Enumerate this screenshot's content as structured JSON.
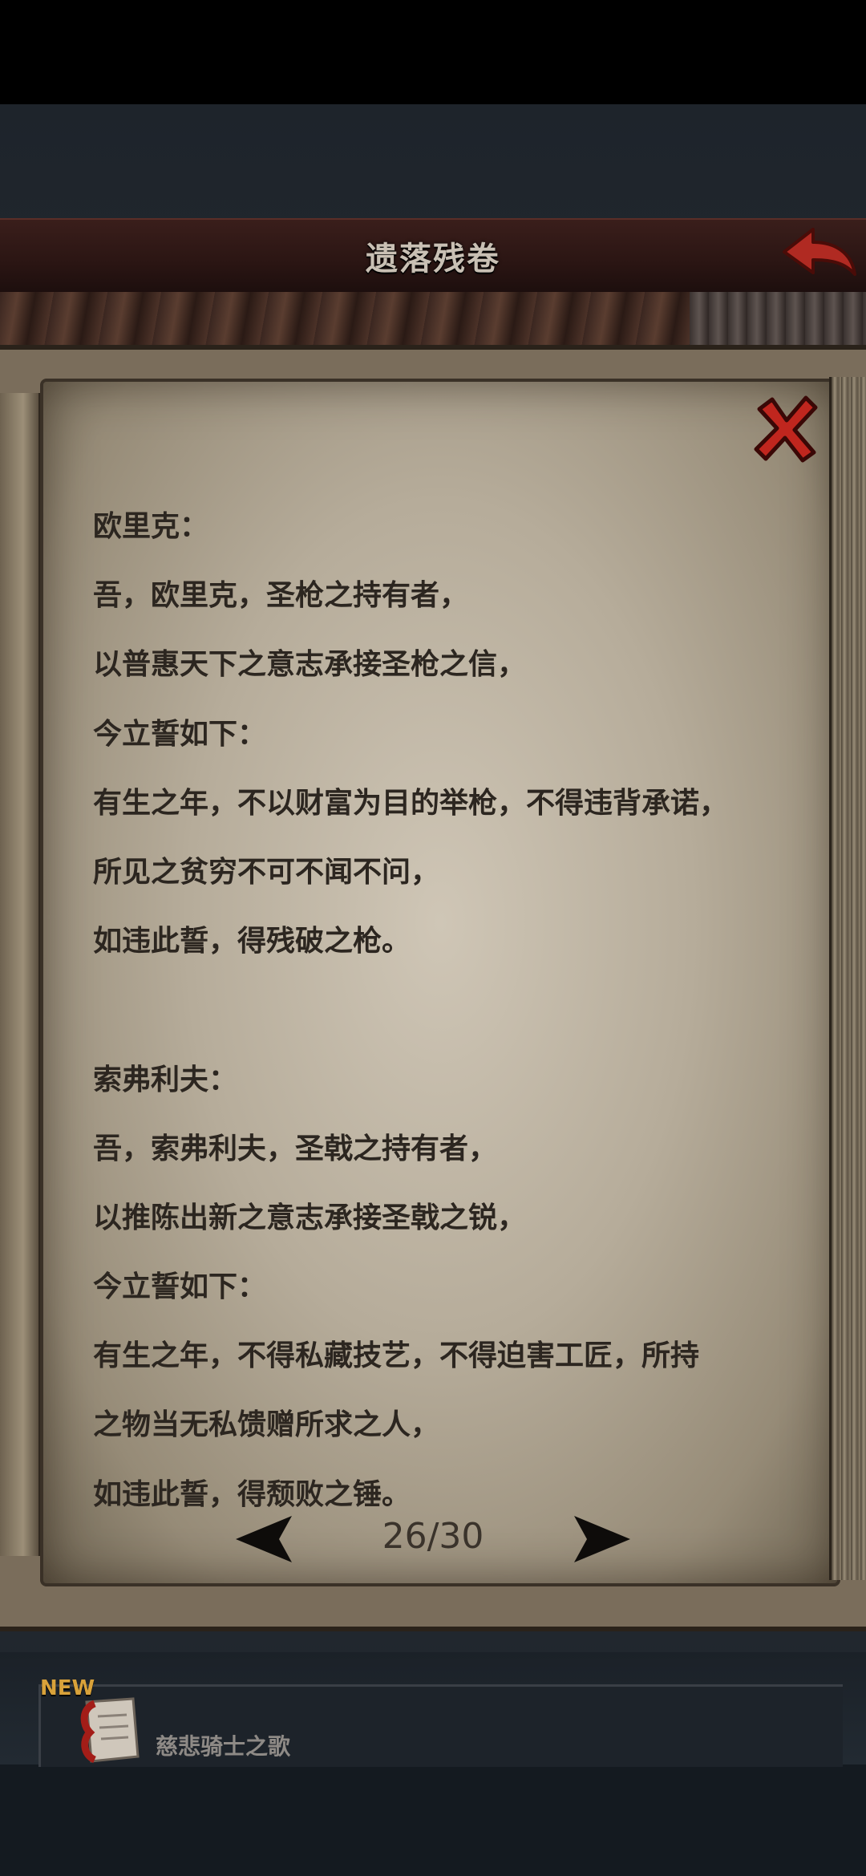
{
  "header": {
    "title": "遗落残卷"
  },
  "document": {
    "lines": [
      "欧里克：",
      "吾，欧里克，圣枪之持有者，",
      "以普惠天下之意志承接圣枪之信，",
      "今立誓如下：",
      "有生之年，不以财富为目的举枪，不得违背承诺，",
      "所见之贫穷不可不闻不问，",
      "如违此誓，得残破之枪。",
      "",
      "索弗利夫：",
      "吾，索弗利夫，圣戟之持有者，",
      "以推陈出新之意志承接圣戟之锐，",
      "今立誓如下：",
      "有生之年，不得私藏技艺，不得迫害工匠，所持",
      "之物当无私馈赠所求之人，",
      "如违此誓，得颓败之锤。"
    ]
  },
  "pager": {
    "page": "26/30",
    "current": 26,
    "total": 30
  },
  "list": {
    "items": [
      {
        "badge": "NEW",
        "label": "慈悲骑士之歌",
        "icon": "scroll-icon"
      }
    ]
  },
  "icons": {
    "back": "back-arrow-icon",
    "close": "close-icon",
    "prev": "prev-page-icon",
    "next": "next-page-icon"
  },
  "colors": {
    "header_bg": "#2a1513",
    "back_arrow": "#b02a22",
    "close_x": "#c0261e",
    "parchment": "#bfb5a3",
    "text": "#2c2620",
    "new_badge": "#d9a23a"
  }
}
